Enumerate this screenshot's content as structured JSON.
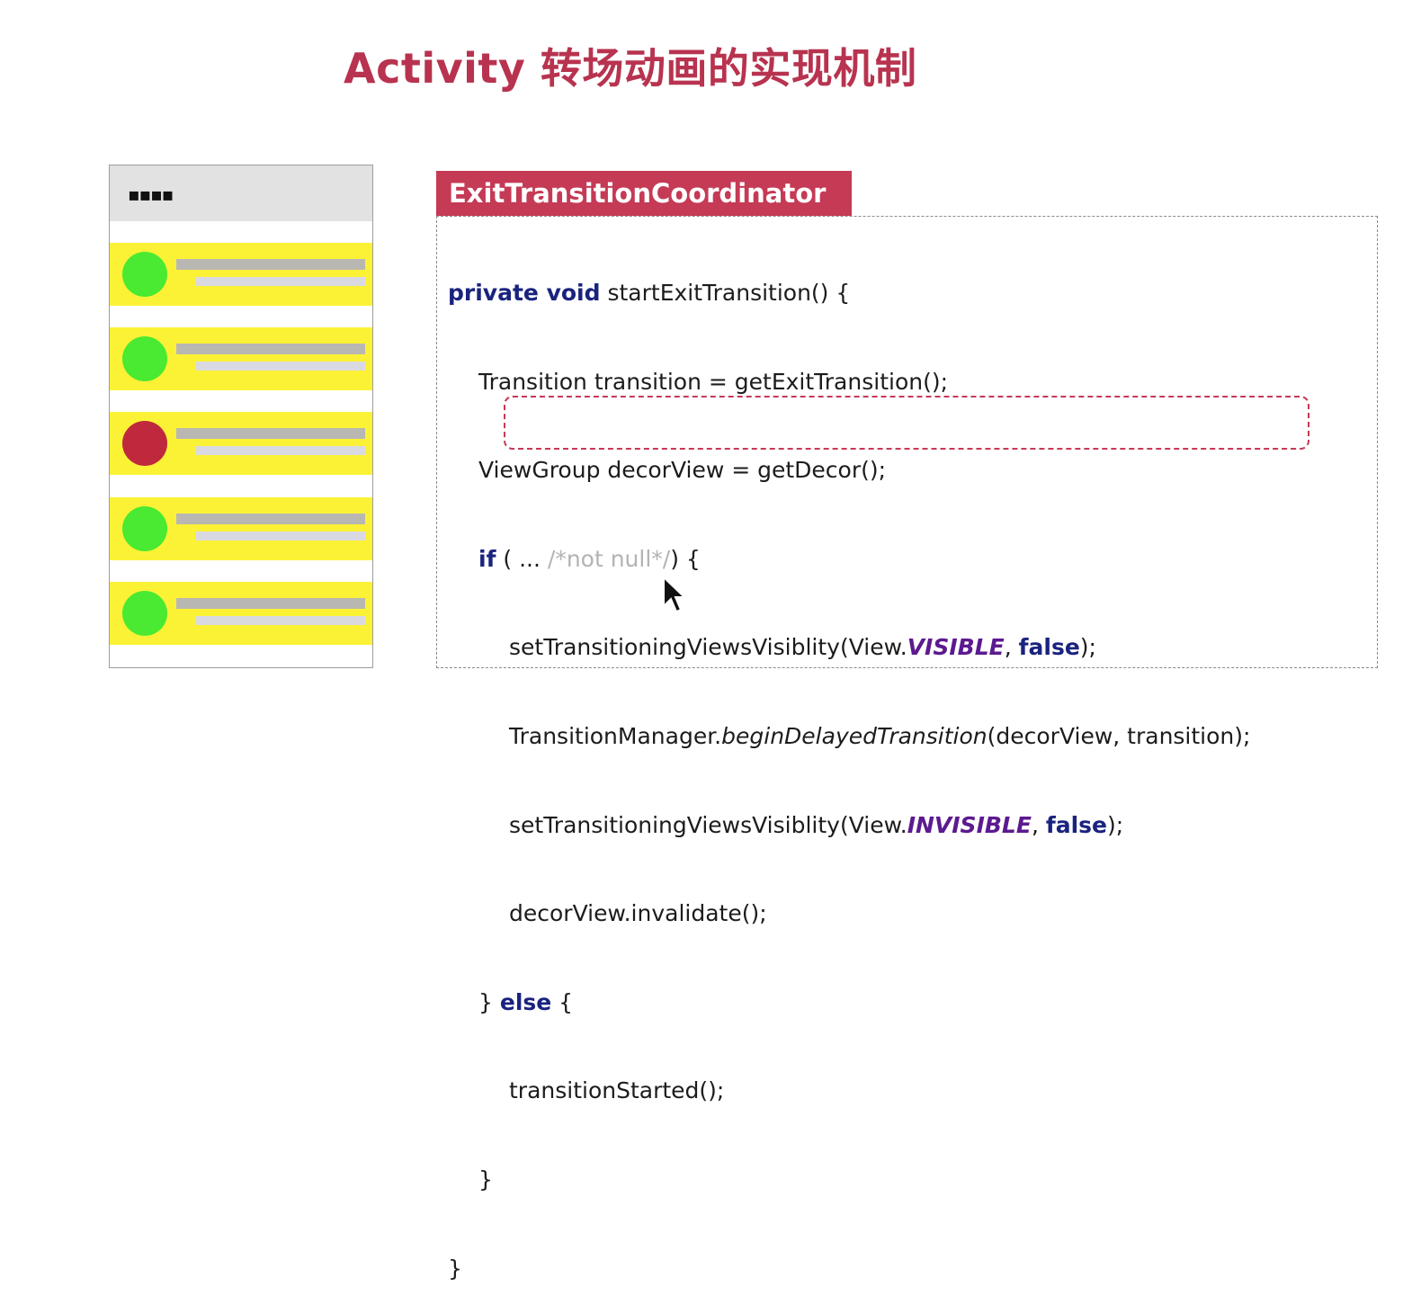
{
  "slide": {
    "title": "Activity 转场动画的实现机制"
  },
  "phone": {
    "status_dots": "▪▪▪▪",
    "rows": [
      {
        "avatar_color": "#49ea31"
      },
      {
        "avatar_color": "#49ea31"
      },
      {
        "avatar_color": "#c0283e"
      },
      {
        "avatar_color": "#49ea31"
      },
      {
        "avatar_color": "#49ea31"
      }
    ]
  },
  "code_panel": {
    "header": "ExitTransitionCoordinator",
    "lines": {
      "l1_kw": "private void",
      "l1_rest": " startExitTransition() {",
      "l2": "Transition transition = getExitTransition();",
      "l3": "ViewGroup decorView = getDecor();",
      "l4_kw": "if",
      "l4_a": " ( ... ",
      "l4_comment": "/*not null*/",
      "l4_b": ") {",
      "l5_a": "setTransitioningViewsVisiblity(View.",
      "l5_const": "VISIBLE",
      "l5_b": ", ",
      "l5_kw": "false",
      "l5_c": ");",
      "l6_a": "TransitionManager.",
      "l6_italic": "beginDelayedTransition",
      "l6_b": "(decorView, transition);",
      "l7_a": "setTransitioningViewsVisiblity(View.",
      "l7_const": "INVISIBLE",
      "l7_b": ", ",
      "l7_kw": "false",
      "l7_c": ");",
      "l8": "decorView.invalidate();",
      "l9_a": "} ",
      "l9_kw": "else",
      "l9_b": " {",
      "l10": "transitionStarted();",
      "l11": "}",
      "l12": "}"
    },
    "highlight_color": "#c53a55",
    "accent_color": "#c53a55"
  },
  "cursor": {
    "icon": "mouse-pointer-icon"
  }
}
